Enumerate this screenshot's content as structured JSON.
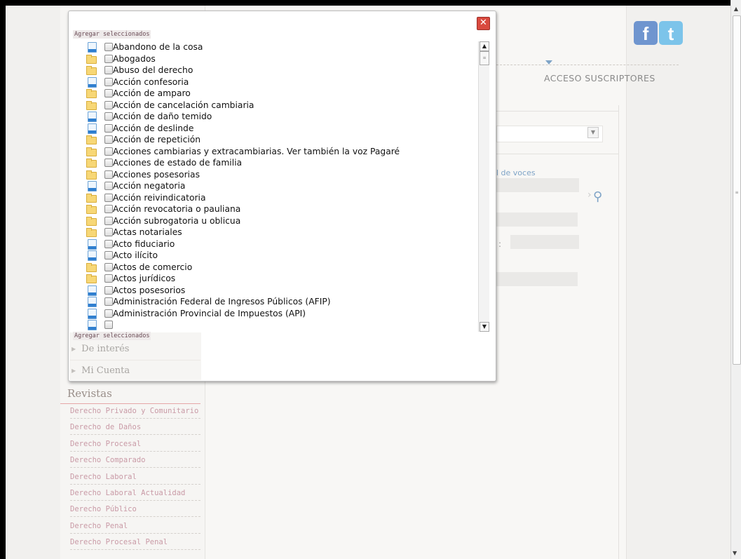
{
  "header": {
    "acceso_label": "ACCESO SUSCRIPTORES",
    "facebook_glyph": "f",
    "twitter_glyph": "t"
  },
  "search_panel": {
    "voces_link": "l de voces",
    "colon": ":"
  },
  "left_menu": {
    "items": [
      {
        "label": "De interés"
      },
      {
        "label": "Mi Cuenta"
      }
    ]
  },
  "revistas": {
    "title": "Revistas",
    "items": [
      {
        "label": "Derecho Privado y Comunitario"
      },
      {
        "label": "Derecho de Daños"
      },
      {
        "label": "Derecho Procesal"
      },
      {
        "label": "Derecho Comparado"
      },
      {
        "label": "Derecho Laboral"
      },
      {
        "label": "Derecho Laboral Actualidad"
      },
      {
        "label": "Derecho Público"
      },
      {
        "label": "Derecho Penal"
      },
      {
        "label": "Derecho Procesal Penal"
      }
    ]
  },
  "popup": {
    "add_selected_top": "Agregar seleccionados",
    "add_selected_bottom": "Agregar seleccionados",
    "close_glyph": "✕",
    "entries": [
      {
        "label": "Abandono de la cosa",
        "icon": "document-icon"
      },
      {
        "label": "Abogados",
        "icon": "folder-icon"
      },
      {
        "label": "Abuso del derecho",
        "icon": "folder-icon"
      },
      {
        "label": "Acción confesoria",
        "icon": "document-icon"
      },
      {
        "label": "Acción de amparo",
        "icon": "folder-icon"
      },
      {
        "label": "Acción de cancelación cambiaria",
        "icon": "folder-icon"
      },
      {
        "label": "Acción de daño temido",
        "icon": "document-icon"
      },
      {
        "label": "Acción de deslinde",
        "icon": "document-icon"
      },
      {
        "label": "Acción de repetición",
        "icon": "folder-icon"
      },
      {
        "label": "Acciones cambiarias y extracambiarias. Ver también la voz Pagaré",
        "icon": "folder-icon"
      },
      {
        "label": "Acciones de estado de familia",
        "icon": "folder-icon"
      },
      {
        "label": "Acciones posesorias",
        "icon": "folder-icon"
      },
      {
        "label": "Acción negatoria",
        "icon": "document-icon"
      },
      {
        "label": "Acción reivindicatoria",
        "icon": "folder-icon"
      },
      {
        "label": "Acción revocatoria o pauliana",
        "icon": "folder-icon"
      },
      {
        "label": "Acción subrogatoria u oblicua",
        "icon": "folder-icon"
      },
      {
        "label": "Actas notariales",
        "icon": "folder-icon"
      },
      {
        "label": "Acto fiduciario",
        "icon": "document-icon"
      },
      {
        "label": "Acto ilícito",
        "icon": "document-icon"
      },
      {
        "label": "Actos de comercio",
        "icon": "folder-icon"
      },
      {
        "label": "Actos jurídicos",
        "icon": "folder-icon"
      },
      {
        "label": "Actos posesorios",
        "icon": "document-icon"
      },
      {
        "label": "Administración Federal de Ingresos Públicos (AFIP)",
        "icon": "document-icon"
      },
      {
        "label": "Administración Provincial de Impuestos (API)",
        "icon": "document-icon"
      },
      {
        "label": "",
        "icon": "document-icon"
      }
    ]
  },
  "colors": {
    "close_red": "#d94a3f",
    "link_blue": "#7fa4c7",
    "revista_pink": "#c99aa6"
  }
}
